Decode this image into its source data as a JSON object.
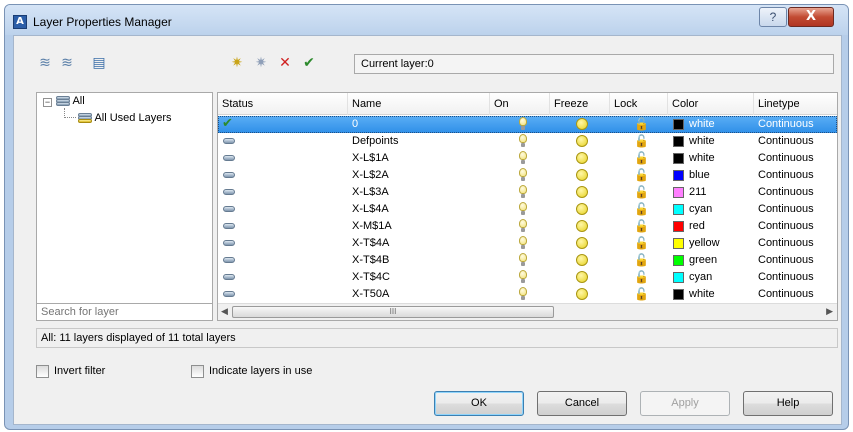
{
  "window": {
    "title": "Layer Properties Manager",
    "help_button": "?",
    "close_button": "X"
  },
  "toolbar": {
    "current_layer": "Current layer:0"
  },
  "tree": {
    "root": "All",
    "child": "All Used Layers"
  },
  "search": {
    "placeholder": "Search for layer"
  },
  "grid": {
    "columns": [
      "Status",
      "Name",
      "On",
      "Freeze",
      "Lock",
      "Color",
      "Linetype"
    ],
    "rows": [
      {
        "name": "0",
        "color_name": "white",
        "swatch": "#000000",
        "linetype": "Continuous",
        "current": true
      },
      {
        "name": "Defpoints",
        "color_name": "white",
        "swatch": "#000000",
        "linetype": "Continuous",
        "current": false
      },
      {
        "name": "X-L$1A",
        "color_name": "white",
        "swatch": "#000000",
        "linetype": "Continuous",
        "current": false
      },
      {
        "name": "X-L$2A",
        "color_name": "blue",
        "swatch": "#0000ff",
        "linetype": "Continuous",
        "current": false
      },
      {
        "name": "X-L$3A",
        "color_name": "211",
        "swatch": "#ff7fff",
        "linetype": "Continuous",
        "current": false
      },
      {
        "name": "X-L$4A",
        "color_name": "cyan",
        "swatch": "#00ffff",
        "linetype": "Continuous",
        "current": false
      },
      {
        "name": "X-M$1A",
        "color_name": "red",
        "swatch": "#ff0000",
        "linetype": "Continuous",
        "current": false
      },
      {
        "name": "X-T$4A",
        "color_name": "yellow",
        "swatch": "#ffff00",
        "linetype": "Continuous",
        "current": false
      },
      {
        "name": "X-T$4B",
        "color_name": "green",
        "swatch": "#00ff00",
        "linetype": "Continuous",
        "current": false
      },
      {
        "name": "X-T$4C",
        "color_name": "cyan",
        "swatch": "#00ffff",
        "linetype": "Continuous",
        "current": false
      },
      {
        "name": "X-T50A",
        "color_name": "white",
        "swatch": "#000000",
        "linetype": "Continuous",
        "current": false
      }
    ],
    "scroll_grip": "III"
  },
  "summary": "All:  11 layers displayed of  11 total layers",
  "options": {
    "invert_filter": {
      "label": "Invert filter",
      "checked": false
    },
    "indicate_in_use": {
      "label": "Indicate layers in use",
      "checked": false
    }
  },
  "buttons": {
    "ok": "OK",
    "cancel": "Cancel",
    "apply": "Apply",
    "help": "Help"
  }
}
